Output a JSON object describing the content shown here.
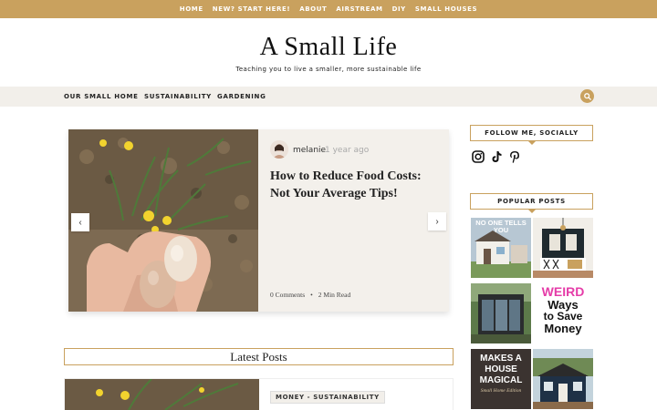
{
  "topnav": {
    "items": [
      "HOME",
      "NEW? START HERE!",
      "ABOUT",
      "AIRSTREAM",
      "DIY",
      "SMALL HOUSES"
    ]
  },
  "header": {
    "title": "A Small Life",
    "tagline": "Teaching you to live a smaller, more sustainable life"
  },
  "mainnav": {
    "items": [
      "OUR SMALL HOME",
      "SUSTAINABILITY",
      "GARDENING"
    ],
    "search_icon": "search-icon"
  },
  "featured": {
    "author": "melanie",
    "age": "1 year ago",
    "title": "How to Reduce Food Costs: Not Your Average Tips!",
    "comments": "0 Comments",
    "separator": "•",
    "read_time": "2 Min Read",
    "prev_label": "‹",
    "next_label": "›"
  },
  "latest": {
    "header": "Latest Posts",
    "first_post_category": "MONEY - SUSTAINABILITY"
  },
  "sidebar": {
    "follow_title": "FOLLOW ME, SOCIALLY",
    "social_icons": [
      "instagram-icon",
      "tiktok-icon",
      "pinterest-icon"
    ],
    "popular_title": "POPULAR POSTS",
    "popular_texts": {
      "thumb1": "NO ONE TELLS YOU",
      "thumb4_line1": "WEIRD",
      "thumb4_line2": "Ways",
      "thumb4_line3": "to Save",
      "thumb4_line4": "Money",
      "thumb5_line1": "MAKES A",
      "thumb5_line2": "HOUSE",
      "thumb5_line3": "MAGICAL",
      "thumb5_line4": "Small Home Edition"
    }
  },
  "colors": {
    "accent": "#c9a15e",
    "nav_bg": "#f2efea",
    "card_bg": "#f3f0eb"
  }
}
